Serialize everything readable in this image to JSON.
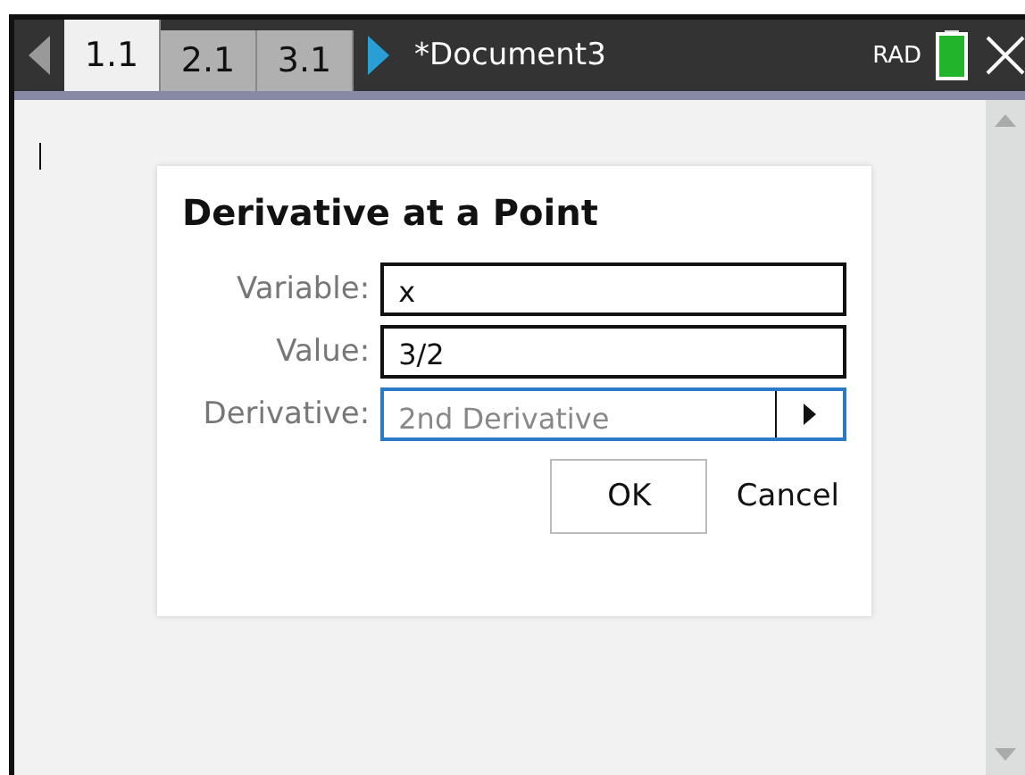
{
  "tab_bar": {
    "tabs": [
      {
        "label": "1.1",
        "selected": true
      },
      {
        "label": "2.1",
        "selected": false
      },
      {
        "label": "3.1",
        "selected": false
      }
    ],
    "document_title": "*Document3",
    "angle_mode": "RAD"
  },
  "dialog": {
    "title": "Derivative at a Point",
    "fields": [
      {
        "kind": "text",
        "label": "Variable:",
        "value": "x",
        "focused": false
      },
      {
        "kind": "text",
        "label": "Value:",
        "value": "3/2",
        "focused": false
      },
      {
        "kind": "dropdown",
        "label": "Derivative:",
        "value": "2nd Derivative",
        "focused": true
      }
    ],
    "buttons": [
      {
        "label": "OK",
        "kind": "boxed"
      },
      {
        "label": "Cancel",
        "kind": "plain"
      }
    ]
  }
}
